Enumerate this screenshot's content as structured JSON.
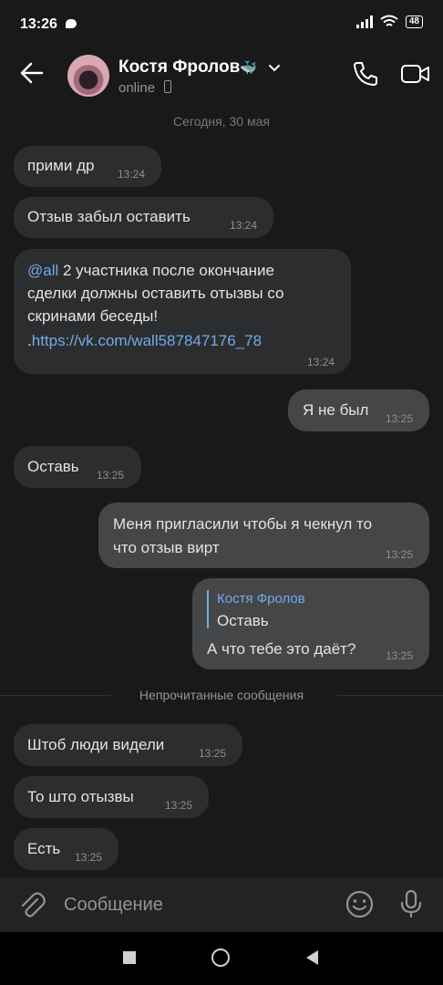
{
  "status_bar": {
    "time": "13:26",
    "battery": "48"
  },
  "header": {
    "name": "Костя Фролов",
    "name_emoji": "🐳",
    "status": "online"
  },
  "chat": {
    "date_separator": "Сегодня, 30 мая",
    "unread_label": "Непрочитанные сообщения",
    "messages": [
      {
        "dir": "in",
        "text": "прими др",
        "time": "13:24"
      },
      {
        "dir": "in",
        "text": "Отзыв забыл оставить",
        "time": "13:24"
      },
      {
        "dir": "in",
        "mention": "@all",
        "line1": " 2 участника после окончание",
        "line2": "сделки должны оставить отызвы со",
        "line3": "скринами беседы!",
        "link_prefix": ".",
        "link": "https://vk.com/wall587847176_78",
        "time": "13:24"
      },
      {
        "dir": "out",
        "text": "Я не был",
        "time": "13:25"
      },
      {
        "dir": "in",
        "text": "Оставь",
        "time": "13:25"
      },
      {
        "dir": "out",
        "line1": "Меня пригласили чтобы я чекнул то",
        "line2": "что отзыв вирт",
        "time": "13:25"
      },
      {
        "dir": "out",
        "reply_author": "Костя Фролов",
        "reply_text": "Оставь",
        "text": "А что тебе это даёт?",
        "time": "13:25"
      },
      {
        "dir": "in",
        "text": "Штоб люди видели",
        "time": "13:25"
      },
      {
        "dir": "in",
        "text": "То што отызвы",
        "time": "13:25"
      },
      {
        "dir": "in",
        "text": "Есть",
        "time": "13:25"
      }
    ]
  },
  "composer": {
    "placeholder": "Сообщение"
  },
  "icons": {
    "back": "arrow-left-icon",
    "call": "phone-icon",
    "video": "video-camera-icon",
    "attach": "paperclip-icon",
    "emoji": "smile-icon",
    "mic": "microphone-icon"
  },
  "colors": {
    "background": "#19191a",
    "bubble_in": "#2c2d2e",
    "bubble_out": "#454647",
    "link": "#71aaeb"
  }
}
